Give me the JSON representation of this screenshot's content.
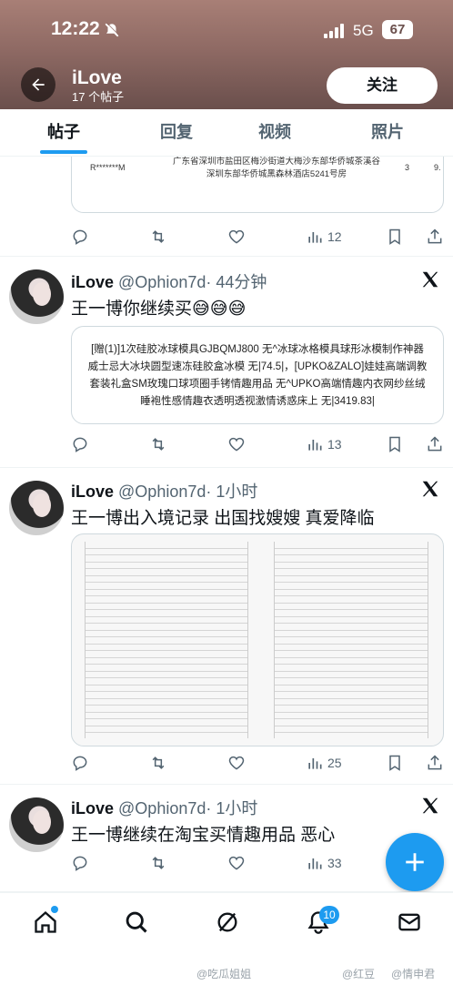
{
  "status_bar": {
    "time": "12:22",
    "network": "5G",
    "battery": "67"
  },
  "header": {
    "name": "iLove",
    "post_count": "17 个帖子",
    "follow_label": "关注"
  },
  "tabs": [
    {
      "label": "帖子"
    },
    {
      "label": "回复"
    },
    {
      "label": "视频"
    },
    {
      "label": "照片"
    }
  ],
  "partial_card": {
    "left_text": "R*******M",
    "address": "广东省深圳市盐田区梅沙街道大梅沙东部华侨城茶溪谷深圳东部华侨城黑森林酒店5241号房",
    "col3": "3",
    "col4": "9."
  },
  "posts": [
    {
      "name": "iLove",
      "handle": "@Ophion7d",
      "time": "· 44分钟",
      "text": "王一博你继续买😅😅😅",
      "card_text": "[赠(1)]1次硅胶冰球模具GJBQMJ800 无^冰球冰格模具球形冰模制作神器威士忌大冰块圆型速冻硅胶盒冰模 无|74.5|，[UPKO&ZALO]娃娃高端调教套装礼盒SM玫瑰口球项圈手铐情趣用品 无^UPKO高端情趣内衣网纱丝绒睡袍性感情趣衣透明透视激情诱惑床上 无|3419.83|",
      "views": "13"
    },
    {
      "name": "iLove",
      "handle": "@Ophion7d",
      "time": "· 1小时",
      "text": "王一博出入境记录 出国找嫂嫂 真爱降临",
      "views": "25"
    },
    {
      "name": "iLove",
      "handle": "@Ophion7d",
      "time": "· 1小时",
      "text": "王一博继续在淘宝买情趣用品 恶心",
      "views": "33"
    }
  ],
  "top_post_views": "12",
  "bottom_nav": {
    "notifications_badge": "10"
  },
  "watermarks": [
    "@吃瓜姐姐",
    "@红豆",
    "@情申君"
  ]
}
